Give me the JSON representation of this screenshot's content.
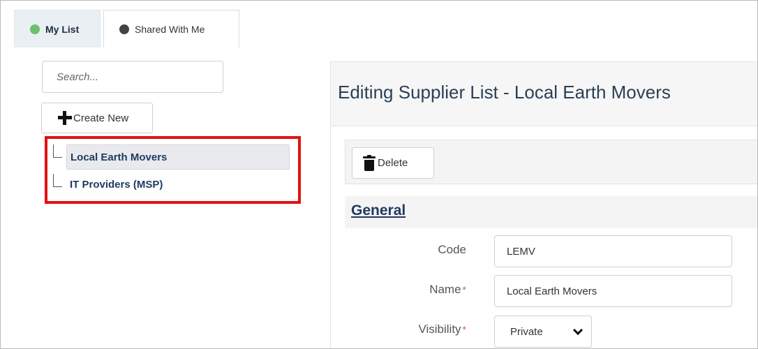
{
  "tabs": [
    {
      "label": "My List",
      "dot_color": "#6cc06c"
    },
    {
      "label": "Shared With Me",
      "dot_color": "#444444"
    }
  ],
  "sidebar": {
    "search_placeholder": "Search...",
    "create_label": "Create New",
    "items": [
      {
        "label": "Local Earth Movers",
        "selected": true
      },
      {
        "label": "IT Providers (MSP)",
        "selected": false
      }
    ],
    "highlight_color": "#e31111"
  },
  "editor": {
    "title": "Editing Supplier List - Local Earth Movers",
    "delete_label": "Delete",
    "section_title": "General",
    "fields": {
      "code": {
        "label": "Code",
        "value": "LEMV"
      },
      "name": {
        "label": "Name",
        "value": "Local Earth Movers",
        "required_mark": "*"
      },
      "visibility": {
        "label": "Visibility",
        "value": "Private",
        "required_mark": "*"
      }
    }
  }
}
